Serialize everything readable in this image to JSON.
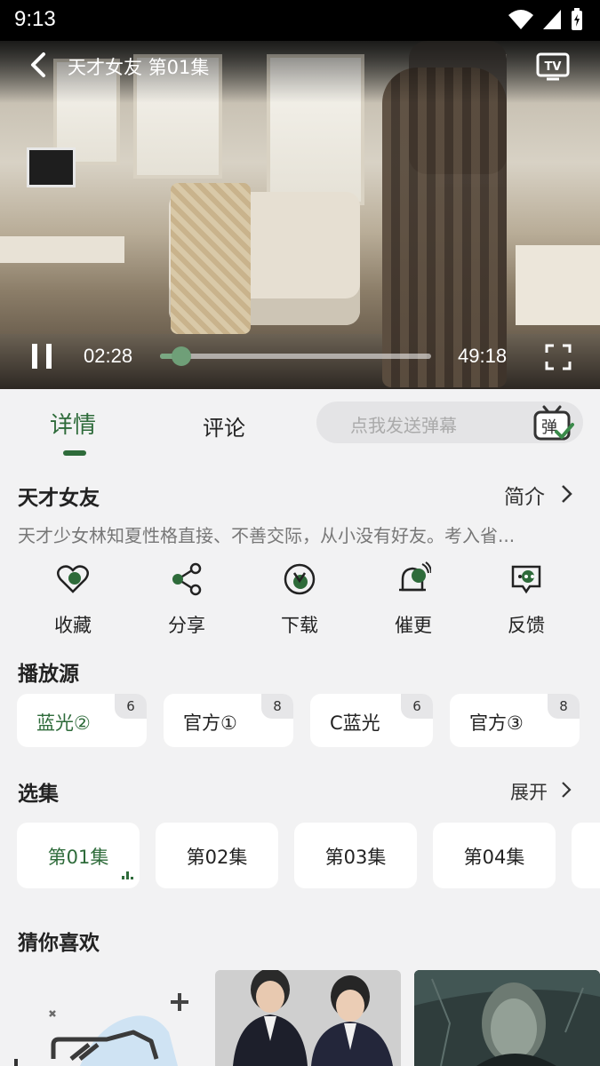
{
  "status_bar": {
    "time": "9:13"
  },
  "player": {
    "title": "天才女友 第01集",
    "current_time": "02:28",
    "duration": "49:18",
    "progress_fraction": 0.05
  },
  "tabs": {
    "details": "详情",
    "comments": "评论"
  },
  "danmu": {
    "placeholder": "点我发送弹幕",
    "icon_char": "弹"
  },
  "show": {
    "title": "天才女友",
    "intro_label": "简介",
    "description": "天才少女林知夏性格直接、不善交际，从小没有好友。考入省..."
  },
  "actions": [
    {
      "label": "收藏",
      "icon": "heart-icon"
    },
    {
      "label": "分享",
      "icon": "share-icon"
    },
    {
      "label": "下载",
      "icon": "download-icon"
    },
    {
      "label": "催更",
      "icon": "bell-icon"
    },
    {
      "label": "反馈",
      "icon": "feedback-icon"
    }
  ],
  "sources": {
    "title": "播放源",
    "items": [
      {
        "name": "蓝光②",
        "count": "6"
      },
      {
        "name": "官方①",
        "count": "8"
      },
      {
        "name": "C蓝光",
        "count": "6"
      },
      {
        "name": "官方③",
        "count": "8"
      }
    ]
  },
  "episodes": {
    "title": "选集",
    "expand_label": "展开",
    "items": [
      "第01集",
      "第02集",
      "第03集",
      "第04集"
    ]
  },
  "recommend": {
    "title": "猜你喜欢"
  },
  "colors": {
    "accent": "#2e6b3a",
    "background": "#f2f2f3"
  }
}
